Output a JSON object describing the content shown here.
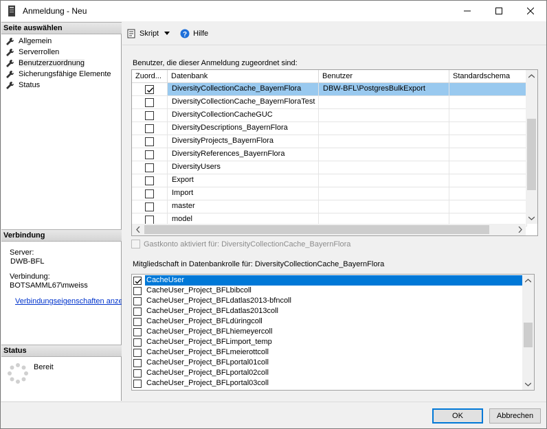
{
  "window": {
    "title": "Anmeldung - Neu"
  },
  "left": {
    "select_page_header": "Seite auswählen",
    "nav": [
      {
        "label": "Allgemein"
      },
      {
        "label": "Serverrollen"
      },
      {
        "label": "Benutzerzuordnung"
      },
      {
        "label": "Sicherungsfähige Elemente"
      },
      {
        "label": "Status"
      }
    ],
    "connection_header": "Verbindung",
    "server_label": "Server:",
    "server_value": "DWB-BFL",
    "connection_label": "Verbindung:",
    "connection_value": "BOTSAMML67\\mweiss",
    "connection_props_link": "Verbindungseigenschaften anzeigen",
    "status_header": "Status",
    "status_value": "Bereit"
  },
  "toolbar": {
    "script_label": "Skript",
    "help_label": "Hilfe"
  },
  "mapping": {
    "caption": "Benutzer, die dieser Anmeldung zugeordnet sind:",
    "columns": [
      "Zuord...",
      "Datenbank",
      "Benutzer",
      "Standardschema"
    ],
    "rows": [
      {
        "checked": true,
        "database": "DiversityCollectionCache_BayernFlora",
        "user": "DBW-BFL\\PostgresBulkExport",
        "schema": ""
      },
      {
        "checked": false,
        "database": "DiversityCollectionCache_BayernFloraTest",
        "user": "",
        "schema": ""
      },
      {
        "checked": false,
        "database": "DiversityCollectionCacheGUC",
        "user": "",
        "schema": ""
      },
      {
        "checked": false,
        "database": "DiversityDescriptions_BayernFlora",
        "user": "",
        "schema": ""
      },
      {
        "checked": false,
        "database": "DiversityProjects_BayernFlora",
        "user": "",
        "schema": ""
      },
      {
        "checked": false,
        "database": "DiversityReferences_BayernFlora",
        "user": "",
        "schema": ""
      },
      {
        "checked": false,
        "database": "DiversityUsers",
        "user": "",
        "schema": ""
      },
      {
        "checked": false,
        "database": "Export",
        "user": "",
        "schema": ""
      },
      {
        "checked": false,
        "database": "Import",
        "user": "",
        "schema": ""
      },
      {
        "checked": false,
        "database": "master",
        "user": "",
        "schema": ""
      },
      {
        "checked": false,
        "database": "model",
        "user": "",
        "schema": ""
      }
    ],
    "guest_label": "Gastkonto aktiviert für: DiversityCollectionCache_BayernFlora"
  },
  "roles": {
    "caption": "Mitgliedschaft in Datenbankrolle für: DiversityCollectionCache_BayernFlora",
    "items": [
      {
        "checked": true,
        "label": "CacheUser"
      },
      {
        "checked": false,
        "label": "CacheUser_Project_BFLbibcoll"
      },
      {
        "checked": false,
        "label": "CacheUser_Project_BFLdatlas2013-bfncoll"
      },
      {
        "checked": false,
        "label": "CacheUser_Project_BFLdatlas2013coll"
      },
      {
        "checked": false,
        "label": "CacheUser_Project_BFLdüringcoll"
      },
      {
        "checked": false,
        "label": "CacheUser_Project_BFLhiemeyercoll"
      },
      {
        "checked": false,
        "label": "CacheUser_Project_BFLimport_temp"
      },
      {
        "checked": false,
        "label": "CacheUser_Project_BFLmeierottcoll"
      },
      {
        "checked": false,
        "label": "CacheUser_Project_BFLportal01coll"
      },
      {
        "checked": false,
        "label": "CacheUser_Project_BFLportal02coll"
      },
      {
        "checked": false,
        "label": "CacheUser_Project_BFLportal03coll"
      }
    ]
  },
  "buttons": {
    "ok": "OK",
    "cancel": "Abbrechen"
  },
  "colors": {
    "selection_light": "#99c9ef",
    "selection_dark": "#0078d7",
    "link": "#0033cc"
  }
}
